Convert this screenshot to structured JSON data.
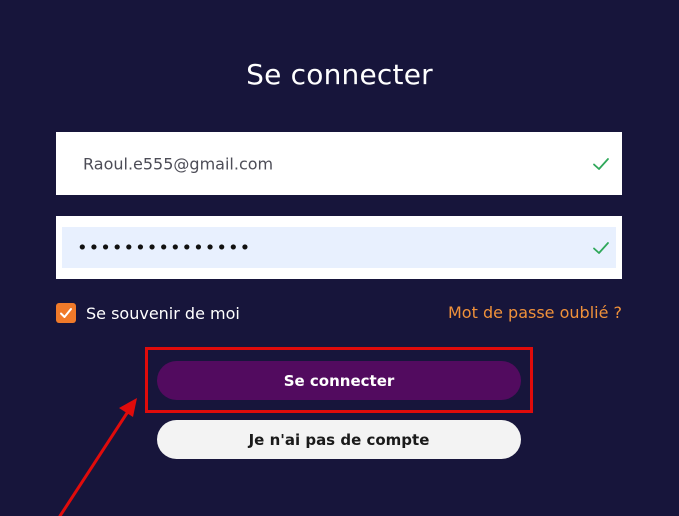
{
  "login": {
    "title": "Se connecter",
    "email_value": "Raoul.e555@gmail.com",
    "password_value": "•••••••••••••••",
    "remember_label": "Se souvenir de moi",
    "remember_checked": true,
    "forgot_link": "Mot de passe oublié ?",
    "submit_label": "Se connecter",
    "no_account_label": "Je n'ai pas de compte"
  },
  "icons": {
    "email_valid": "check-icon",
    "password_valid": "check-icon",
    "remember_check": "checkmark-icon"
  },
  "annotation": {
    "highlight_color": "#e00b0b",
    "arrow_color": "#e00b0b"
  },
  "colors": {
    "background": "#17153b",
    "primary_button": "#520b5f",
    "checkbox": "#f07a2a",
    "link": "#f0913a",
    "valid_check": "#2fa85a"
  }
}
